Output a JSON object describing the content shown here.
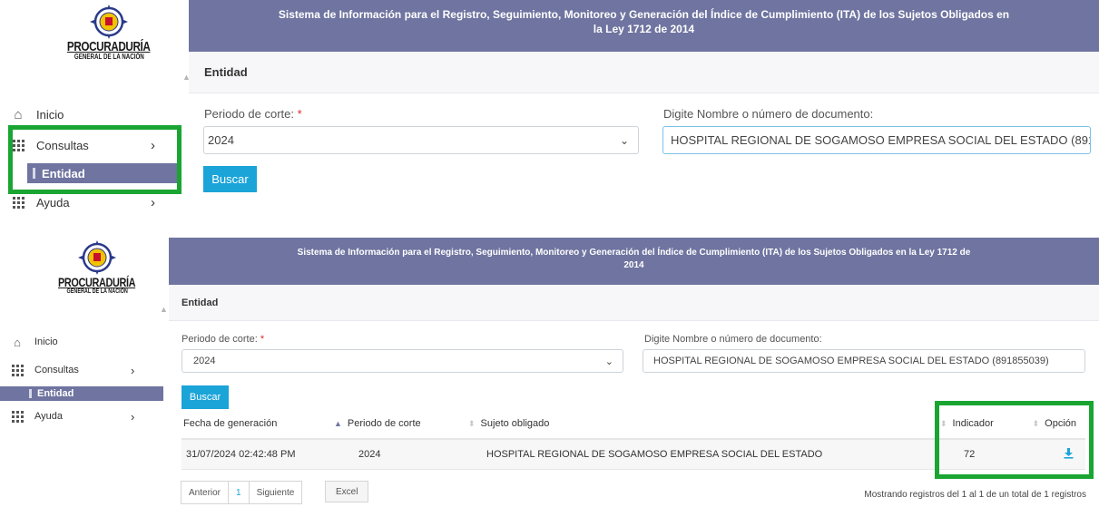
{
  "logo": {
    "line1": "PROCURADURÍA",
    "line2": "GENERAL DE LA NACIÓN"
  },
  "header": {
    "title_line1": "Sistema de Información para el Registro, Seguimiento, Monitoreo y Generación del Índice de Cumplimiento (ITA) de los Sujetos Obligados en",
    "title_line2": "la Ley 1712 de 2014",
    "title2_line1": "Sistema de Información para el Registro, Seguimiento, Monitoreo y Generación del Índice de Cumplimiento (ITA) de los Sujetos Obligados en la Ley 1712 de",
    "title2_line2": "2014"
  },
  "section_title": "Entidad",
  "sidebar": {
    "inicio": "Inicio",
    "consultas": "Consultas",
    "entidad": "Entidad",
    "ayuda": "Ayuda",
    "chevron": "›"
  },
  "form": {
    "periodo_label": "Periodo de corte:",
    "required_mark": "*",
    "periodo_value": "2024",
    "doc_label": "Digite Nombre o número de documento:",
    "doc_value_cut": "HOSPITAL REGIONAL DE SOGAMOSO EMPRESA SOCIAL DEL ESTADO (89185503!",
    "doc_value_full": "HOSPITAL REGIONAL DE SOGAMOSO EMPRESA SOCIAL DEL ESTADO (891855039)",
    "buscar": "Buscar"
  },
  "table": {
    "columns": [
      "Fecha de generación",
      "Periodo de corte",
      "Sujeto obligado",
      "Indicador",
      "Opción"
    ],
    "rows": [
      {
        "fecha": "31/07/2024 02:42:48 PM",
        "periodo": "2024",
        "sujeto": "HOSPITAL REGIONAL DE SOGAMOSO EMPRESA SOCIAL DEL ESTADO",
        "indicador": "72"
      }
    ]
  },
  "pager": {
    "prev": "Anterior",
    "page": "1",
    "next": "Siguiente",
    "excel": "Excel"
  },
  "info": "Mostrando registros del 1 al 1 de un total de 1 registros",
  "colors": {
    "header": "#6f74a0",
    "accent": "#1ba4d8",
    "highlight": "#1aa532",
    "required": "#e0282b"
  },
  "icons": [
    "emblem-icon",
    "home-icon",
    "grid-icon",
    "chevron-right-icon",
    "download-icon",
    "sort-icon"
  ]
}
